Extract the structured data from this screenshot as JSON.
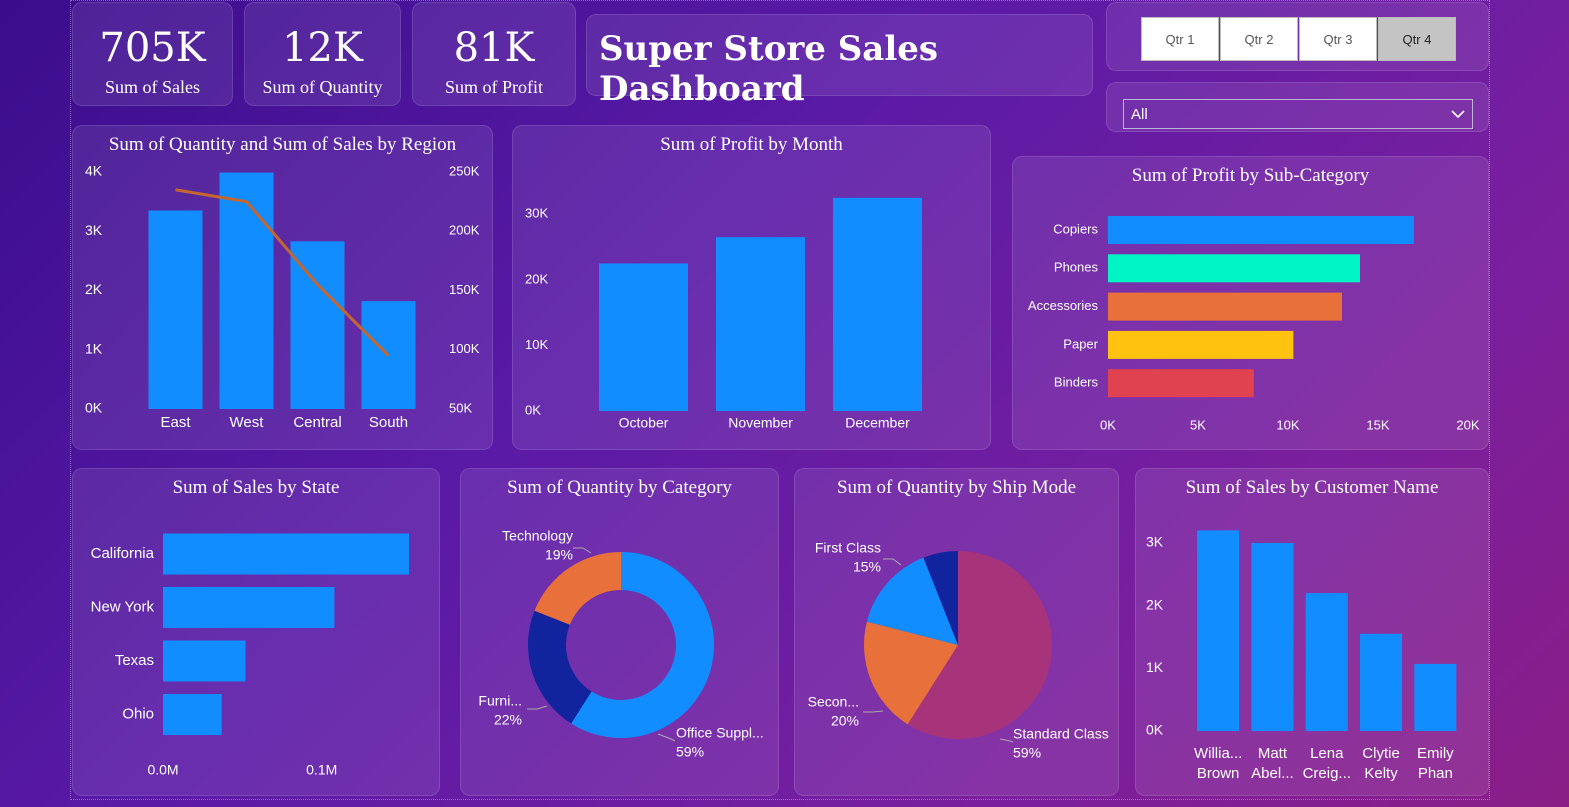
{
  "kpis": [
    {
      "value": "705K",
      "label": "Sum of Sales"
    },
    {
      "value": "12K",
      "label": "Sum of Quantity"
    },
    {
      "value": "81K",
      "label": "Sum of Profit"
    }
  ],
  "dashboard_title": "Super Store Sales Dashboard",
  "slicer": {
    "buttons": [
      "Qtr 1",
      "Qtr 2",
      "Qtr 3",
      "Qtr 4"
    ],
    "active": "Qtr 4",
    "dropdown_value": "All"
  },
  "colors": {
    "bar_blue": "#118dff",
    "line": "#c4662f",
    "phones": "#00f5c4",
    "accessories": "#e8703a",
    "paper": "#ffc20e",
    "binders": "#e0424f",
    "dark_blue": "#12239e",
    "standard_class": "#a7347a"
  },
  "chart_data": [
    {
      "id": "region",
      "type": "bar",
      "title": "Sum of Quantity and Sum of Sales by Region",
      "categories": [
        "East",
        "West",
        "Central",
        "South"
      ],
      "series": [
        {
          "name": "",
          "kind": "bar",
          "axis": "left",
          "values": [
            3350,
            3990,
            2830,
            1820
          ]
        },
        {
          "name": "",
          "kind": "line",
          "axis": "right",
          "values": [
            235000,
            225000,
            155000,
            95000
          ]
        }
      ],
      "y_ticks_left": [
        "0K",
        "1K",
        "2K",
        "3K",
        "4K"
      ],
      "y_ticks_right": [
        "50K",
        "100K",
        "150K",
        "200K",
        "250K"
      ],
      "ylim_left": [
        0,
        4000
      ],
      "ylim_right": [
        50000,
        250000
      ]
    },
    {
      "id": "month",
      "type": "bar",
      "title": "Sum of Profit by Month",
      "categories": [
        "October",
        "November",
        "December"
      ],
      "values": [
        22500,
        26500,
        32500
      ],
      "y_ticks": [
        "0K",
        "10K",
        "20K",
        "30K"
      ],
      "ylim": [
        0,
        34000
      ]
    },
    {
      "id": "subcategory",
      "type": "bar",
      "orientation": "horizontal",
      "title": "Sum of Profit by Sub-Category",
      "categories": [
        "Copiers",
        "Phones",
        "Accessories",
        "Paper",
        "Binders"
      ],
      "values": [
        17000,
        14000,
        13000,
        10300,
        8100
      ],
      "x_ticks": [
        "0K",
        "5K",
        "10K",
        "15K",
        "20K"
      ],
      "xlim": [
        0,
        20000
      ]
    },
    {
      "id": "state",
      "type": "bar",
      "orientation": "horizontal",
      "title": "Sum of Sales by State",
      "categories": [
        "California",
        "New York",
        "Texas",
        "Ohio"
      ],
      "values": [
        0.155,
        0.108,
        0.052,
        0.037
      ],
      "x_ticks": [
        "0.0M",
        "0.1M"
      ],
      "xlim": [
        0,
        0.155
      ]
    },
    {
      "id": "category",
      "type": "pie",
      "donut": true,
      "title": "Sum of Quantity by Category",
      "slices": [
        {
          "label": "Office Suppl...",
          "pct": "59%",
          "value": 59
        },
        {
          "label": "Furni...",
          "pct": "22%",
          "value": 22
        },
        {
          "label": "Technology",
          "pct": "19%",
          "value": 19
        }
      ]
    },
    {
      "id": "shipmode",
      "type": "pie",
      "title": "Sum of Quantity by Ship Mode",
      "slices": [
        {
          "label": "Standard Class",
          "pct": "59%",
          "value": 59
        },
        {
          "label": "Secon...",
          "pct": "20%",
          "value": 20
        },
        {
          "label": "First Class",
          "pct": "15%",
          "value": 15
        },
        {
          "label": "",
          "pct": "",
          "value": 6
        }
      ]
    },
    {
      "id": "customer",
      "type": "bar",
      "title": "Sum of Sales by Customer Name",
      "categories": [
        [
          "Willia...",
          "Brown"
        ],
        [
          "Matt",
          "Abel..."
        ],
        [
          "Lena",
          "Creig..."
        ],
        [
          "Clytie",
          "Kelty"
        ],
        [
          "Emily",
          "Phan"
        ]
      ],
      "values": [
        3200,
        3000,
        2200,
        1550,
        1070
      ],
      "y_ticks": [
        "0K",
        "1K",
        "2K",
        "3K"
      ],
      "ylim": [
        0,
        3350
      ]
    }
  ]
}
